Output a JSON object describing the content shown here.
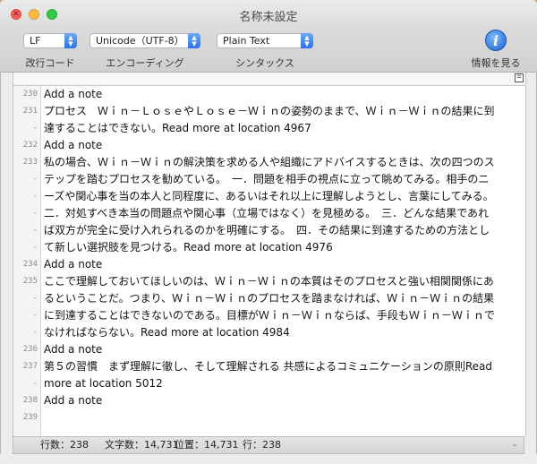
{
  "window": {
    "title": "名称未設定"
  },
  "toolbar": {
    "line_ending": {
      "value": "LF",
      "label": "改行コード"
    },
    "encoding": {
      "value": "Unicode（UTF-8）",
      "label": "エンコーディング"
    },
    "syntax": {
      "value": "Plain Text",
      "label": "シンタックス"
    },
    "info": {
      "icon": "i",
      "label": "情報を見る"
    }
  },
  "editor": {
    "ruler_button": "☰",
    "rows": [
      {
        "ln": "230",
        "text": "Add a note"
      },
      {
        "ln": "231",
        "text": "プロセス　Ｗｉｎ－ＬｏｓｅやＬｏｓｅ－Ｗｉｎの姿勢のままで、Ｗｉｎ－Ｗｉｎの結果に到"
      },
      {
        "ln": "-",
        "text": "達することはできない。Read more at location 4967"
      },
      {
        "ln": "232",
        "text": "Add a note"
      },
      {
        "ln": "233",
        "text": "私の場合、Ｗｉｎ－Ｗｉｎの解決策を求める人や組織にアドバイスするときは、次の四つのス"
      },
      {
        "ln": "-",
        "text": "テップを踏むプロセスを勧めている。　一．問題を相手の視点に立って眺めてみる。相手のニ"
      },
      {
        "ln": "-",
        "text": "ーズや関心事を当の本人と同程度に、あるいはそれ以上に理解しようとし、言葉にしてみる。"
      },
      {
        "ln": "-",
        "text": "二．対処すべき本当の問題点や関心事（立場ではなく）を見極める。　三．どんな結果であれ"
      },
      {
        "ln": "-",
        "text": "ば双方が完全に受け入れられるのかを明確にする。　四．その結果に到達するための方法とし"
      },
      {
        "ln": "-",
        "text": "て新しい選択肢を見つける。Read more at location 4976"
      },
      {
        "ln": "234",
        "text": "Add a note"
      },
      {
        "ln": "235",
        "text": "ここで理解しておいてほしいのは、Ｗｉｎ－Ｗｉｎの本質はそのプロセスと強い相関関係にあ"
      },
      {
        "ln": "-",
        "text": "るということだ。つまり、Ｗｉｎ－Ｗｉｎのプロセスを踏まなければ、Ｗｉｎ－Ｗｉｎの結果"
      },
      {
        "ln": "-",
        "text": "に到達することはできないのである。目標がＷｉｎ－Ｗｉｎならば、手段もＷｉｎ－Ｗｉｎで"
      },
      {
        "ln": "-",
        "text": "なければならない。Read more at location 4984"
      },
      {
        "ln": "236",
        "text": "Add a note"
      },
      {
        "ln": "237",
        "text": "第５の習慣　まず理解に徹し、そして理解される 共感によるコミュニケーションの原則Read"
      },
      {
        "ln": "-",
        "text": "more at location 5012"
      },
      {
        "ln": "238",
        "text": "Add a note"
      },
      {
        "ln": "239",
        "text": ""
      }
    ]
  },
  "status": {
    "lines": "行数：238",
    "chars": "文字数：14,731",
    "position": "位置：14,731",
    "row": "行：238",
    "right": "-"
  }
}
